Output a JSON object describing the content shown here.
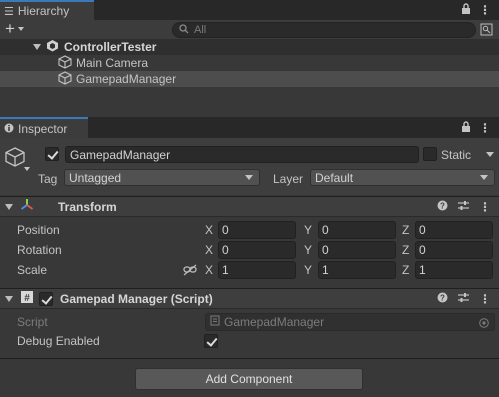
{
  "hierarchy": {
    "tab_title": "Hierarchy",
    "search_placeholder": "All",
    "scene_name": "ControllerTester",
    "items": [
      {
        "label": "Main Camera"
      },
      {
        "label": "GamepadManager"
      }
    ]
  },
  "inspector": {
    "tab_title": "Inspector",
    "object_name": "GamepadManager",
    "static_label": "Static",
    "tag_label": "Tag",
    "tag_value": "Untagged",
    "layer_label": "Layer",
    "layer_value": "Default",
    "transform": {
      "title": "Transform",
      "rows": [
        {
          "label": "Position",
          "x": "0",
          "y": "0",
          "z": "0"
        },
        {
          "label": "Rotation",
          "x": "0",
          "y": "0",
          "z": "0"
        },
        {
          "label": "Scale",
          "x": "1",
          "y": "1",
          "z": "1"
        }
      ],
      "axis_x": "X",
      "axis_y": "Y",
      "axis_z": "Z"
    },
    "script_component": {
      "title": "Gamepad Manager (Script)",
      "script_label": "Script",
      "script_value": "GamepadManager",
      "debug_label": "Debug Enabled",
      "debug_enabled": true
    },
    "add_component_label": "Add Component"
  }
}
